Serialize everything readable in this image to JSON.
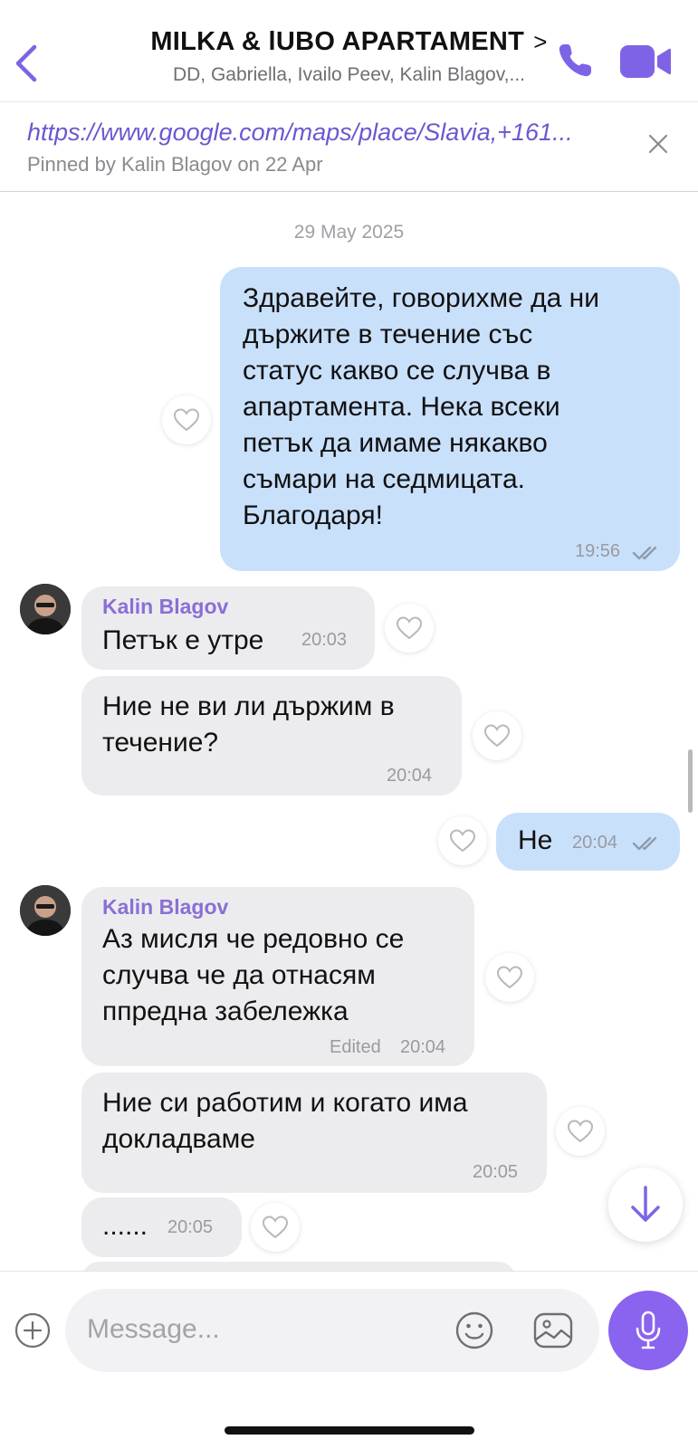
{
  "header": {
    "title": "MILKA & lUBO APARTAMENT",
    "title_chevron": ">",
    "subtitle": "DD, Gabriella, Ivailo Peev, Kalin Blagov,...",
    "accent_color": "#7f63e6"
  },
  "pinned": {
    "link": "https://www.google.com/maps/place/Slavia,+161...",
    "pinned_by": "Pinned by Kalin Blagov on 22 Apr"
  },
  "date_separator": "29 May 2025",
  "messages": [
    {
      "direction": "out",
      "text": "Здравейте, говорихме да ни\nдържите в течение със\nстатус какво се случва в\nапартамента.  Нека всеки\nпетък да имаме някакво\nсъмари на седмицата.\nБлагодаря!",
      "time": "19:56"
    },
    {
      "direction": "in",
      "sender": "Kalin Blagov",
      "text": "Петък е утре",
      "time": "20:03"
    },
    {
      "direction": "in",
      "text": "Ние не ви ли държим в\nтечение?",
      "time": "20:04"
    },
    {
      "direction": "out",
      "text": "Не",
      "time": "20:04"
    },
    {
      "direction": "in",
      "sender": "Kalin Blagov",
      "text": "Аз мисля че редовно се\nслучва че да отнасям\nппредна забележка",
      "edited": "Edited",
      "time": "20:04"
    },
    {
      "direction": "in",
      "text": "Ние си работим и когато има\nдокладваме",
      "time": "20:05"
    },
    {
      "direction": "in",
      "text": "......",
      "time": "20:05"
    }
  ],
  "composer": {
    "placeholder": "Message..."
  },
  "colors": {
    "outgoing_bubble": "#c9e0fb",
    "incoming_bubble": "#ececee",
    "sender_name": "#8a6fd6",
    "mic_button": "#8a63ef"
  },
  "icons": [
    "back-chevron-icon",
    "phone-icon",
    "video-camera-icon",
    "close-icon",
    "heart-icon",
    "double-check-icon",
    "arrow-down-icon",
    "plus-icon",
    "emoji-icon",
    "gallery-icon",
    "microphone-icon"
  ]
}
